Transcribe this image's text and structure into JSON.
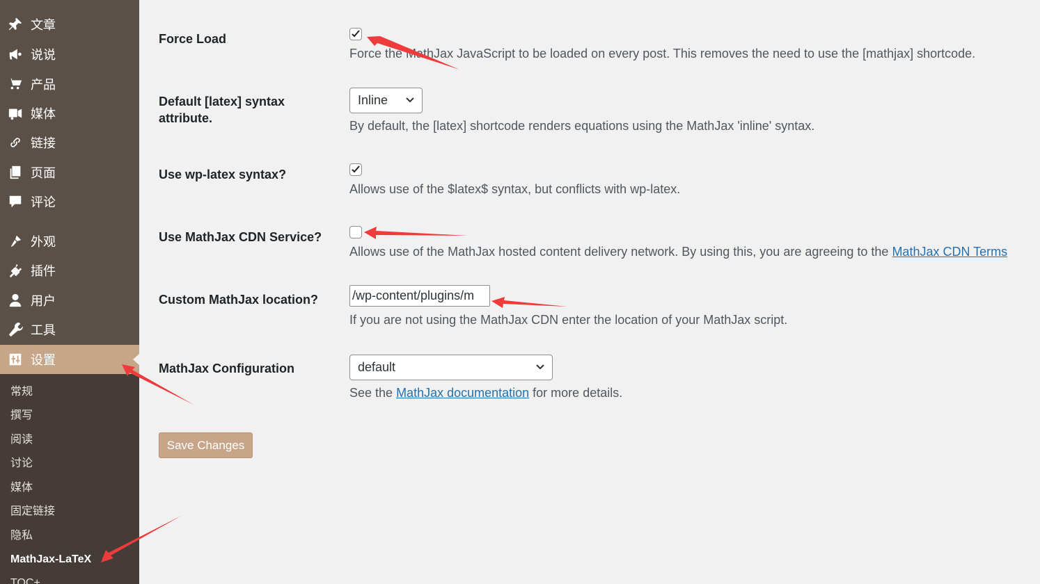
{
  "sidebar": {
    "menu": [
      {
        "label": "文章",
        "icon": "pin-icon"
      },
      {
        "label": "说说",
        "icon": "megaphone-icon"
      },
      {
        "label": "产品",
        "icon": "cart-icon"
      },
      {
        "label": "媒体",
        "icon": "media-icon"
      },
      {
        "label": "链接",
        "icon": "link-icon"
      },
      {
        "label": "页面",
        "icon": "pages-icon"
      },
      {
        "label": "评论",
        "icon": "comment-icon"
      },
      {
        "label": "外观",
        "icon": "brush-icon"
      },
      {
        "label": "插件",
        "icon": "plugin-icon"
      },
      {
        "label": "用户",
        "icon": "user-icon"
      },
      {
        "label": "工具",
        "icon": "wrench-icon"
      },
      {
        "label": "设置",
        "icon": "settings-icon"
      }
    ],
    "submenu": [
      "常规",
      "撰写",
      "阅读",
      "讨论",
      "媒体",
      "固定链接",
      "隐私",
      "MathJax-LaTeX",
      "TOC+"
    ]
  },
  "settings": {
    "force_load": {
      "label": "Force Load",
      "checked": true,
      "description": "Force the MathJax JavaScript to be loaded on every post. This removes the need to use the [mathjax] shortcode."
    },
    "default_latex": {
      "label": "Default [latex] syntax attribute.",
      "selected": "Inline",
      "description": "By default, the [latex] shortcode renders equations using the MathJax 'inline' syntax."
    },
    "wp_latex": {
      "label": "Use wp-latex syntax?",
      "checked": true,
      "description": "Allows use of the $latex$ syntax, but conflicts with wp-latex."
    },
    "cdn": {
      "label": "Use MathJax CDN Service?",
      "checked": false,
      "description": "Allows use of the MathJax hosted content delivery network. By using this, you are agreeing to the ",
      "link": "MathJax CDN Terms"
    },
    "custom_location": {
      "label": "Custom MathJax location?",
      "value": "/wp-content/plugins/m",
      "description": "If you are not using the MathJax CDN enter the location of your MathJax script."
    },
    "config": {
      "label": "MathJax Configuration",
      "selected": "default",
      "description_prefix": "See the ",
      "link": "MathJax documentation",
      "description_suffix": " for more details."
    }
  },
  "save_button": "Save Changes",
  "colors": {
    "sidebar_bg": "#5b5048",
    "submenu_bg": "#463c37",
    "accent": "#c7a589",
    "link": "#2271b1",
    "annotation_arrow": "#ee3b3b"
  }
}
